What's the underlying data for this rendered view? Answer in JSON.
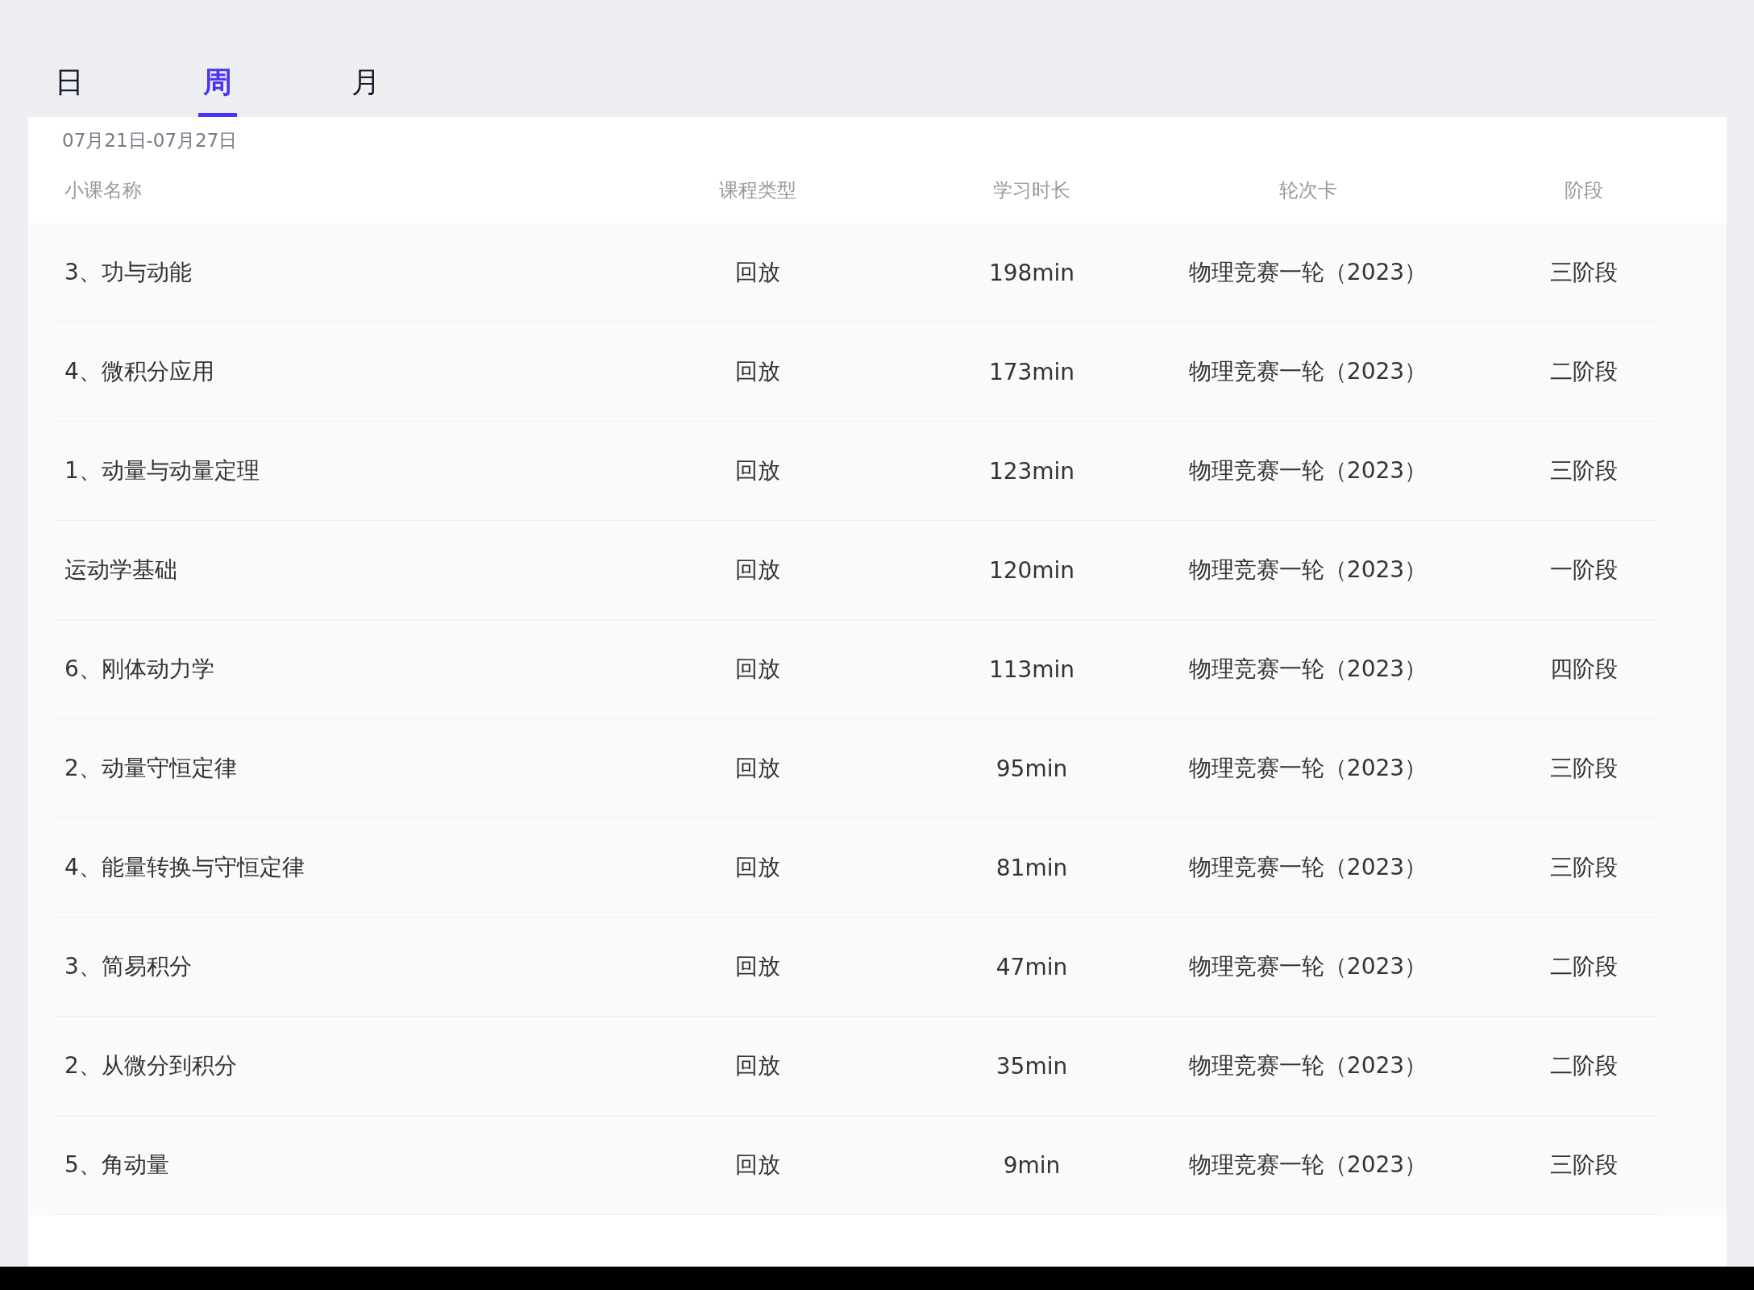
{
  "tabs": [
    {
      "label": "日",
      "selected": false
    },
    {
      "label": "周",
      "selected": true
    },
    {
      "label": "月",
      "selected": false
    }
  ],
  "date_range": "07月21日-07月27日",
  "table": {
    "columns": [
      "小课名称",
      "课程类型",
      "学习时长",
      "轮次卡",
      "阶段"
    ],
    "rows": [
      [
        "3、功与动能",
        "回放",
        "198min",
        "物理竞赛一轮（2023）",
        "三阶段"
      ],
      [
        "4、微积分应用",
        "回放",
        "173min",
        "物理竞赛一轮（2023）",
        "二阶段"
      ],
      [
        "1、动量与动量定理",
        "回放",
        "123min",
        "物理竞赛一轮（2023）",
        "三阶段"
      ],
      [
        "运动学基础",
        "回放",
        "120min",
        "物理竞赛一轮（2023）",
        "一阶段"
      ],
      [
        "6、刚体动力学",
        "回放",
        "113min",
        "物理竞赛一轮（2023）",
        "四阶段"
      ],
      [
        "2、动量守恒定律",
        "回放",
        "95min",
        "物理竞赛一轮（2023）",
        "三阶段"
      ],
      [
        "4、能量转换与守恒定律",
        "回放",
        "81min",
        "物理竞赛一轮（2023）",
        "三阶段"
      ],
      [
        "3、简易积分",
        "回放",
        "47min",
        "物理竞赛一轮（2023）",
        "二阶段"
      ],
      [
        "2、从微分到积分",
        "回放",
        "35min",
        "物理竞赛一轮（2023）",
        "二阶段"
      ],
      [
        "5、角动量",
        "回放",
        "9min",
        "物理竞赛一轮（2023）",
        "三阶段"
      ]
    ]
  }
}
